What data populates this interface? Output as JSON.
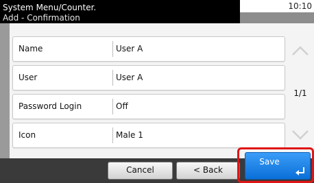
{
  "header": {
    "title": "System Menu/Counter.",
    "subtitle": "Add - Confirmation",
    "time": "10:10"
  },
  "rows": [
    {
      "label": "Name",
      "value": "User A"
    },
    {
      "label": "User",
      "value": "User A"
    },
    {
      "label": "Password Login",
      "value": "Off"
    },
    {
      "label": "Icon",
      "value": "Male 1"
    }
  ],
  "scroll": {
    "page": "1/1",
    "up_icon": "chevron-up-icon",
    "down_icon": "chevron-down-icon"
  },
  "buttons": {
    "cancel": "Cancel",
    "back": "< Back",
    "save": "Save",
    "enter_icon": "enter-arrow-icon"
  },
  "colors": {
    "header_bg": "#000000",
    "save_bg": "#1a84ee",
    "highlight": "#e01515"
  }
}
